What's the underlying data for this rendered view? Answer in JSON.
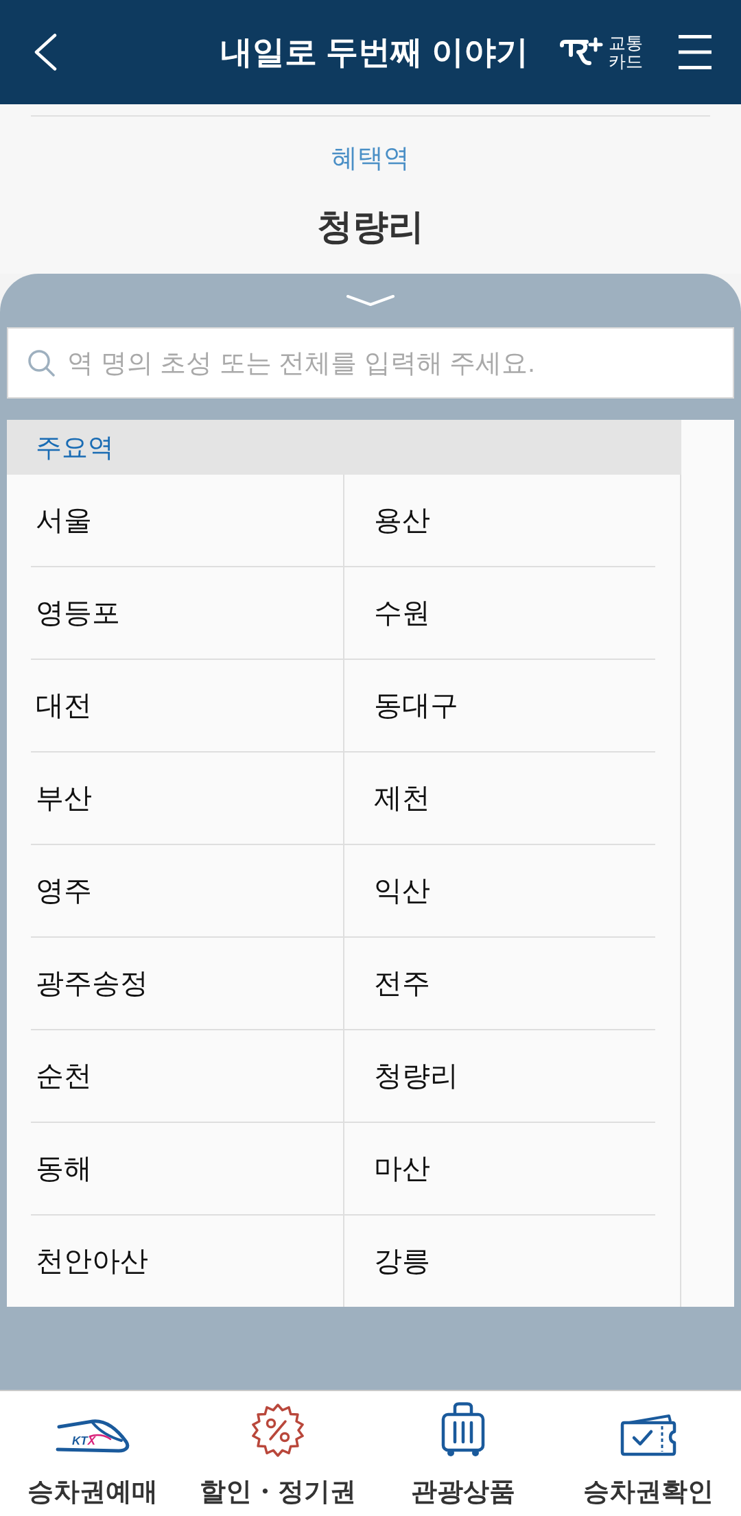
{
  "header": {
    "title": "내일로 두번째 이야기",
    "card_logo": [
      "교통",
      "카드"
    ]
  },
  "benefit": {
    "label": "혜택역",
    "station": "청량리"
  },
  "search": {
    "placeholder": "역 명의 초성 또는 전체를 입력해 주세요."
  },
  "station_section": {
    "title": "주요역",
    "stations": [
      "서울",
      "용산",
      "영등포",
      "수원",
      "대전",
      "동대구",
      "부산",
      "제천",
      "영주",
      "익산",
      "광주송정",
      "전주",
      "순천",
      "청량리",
      "동해",
      "마산",
      "천안아산",
      "강릉"
    ]
  },
  "bottom_nav": [
    {
      "kind": "train",
      "logo_text": "KTX",
      "label": "승차권예매"
    },
    {
      "kind": "discount",
      "label": "할인・정기권"
    },
    {
      "kind": "luggage",
      "label": "관광상품"
    },
    {
      "kind": "ticket",
      "label": "승차권확인"
    }
  ]
}
